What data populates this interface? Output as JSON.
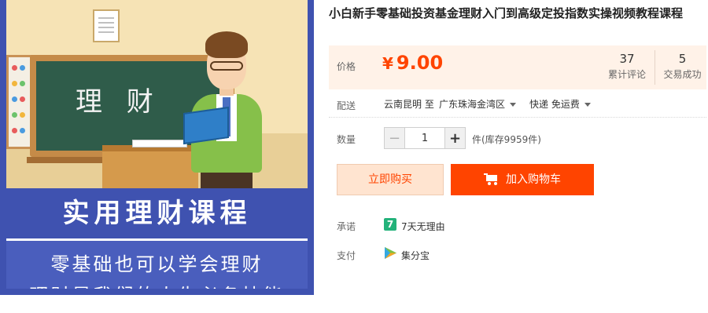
{
  "image": {
    "board_text": "理 财",
    "banner_title": "实用理财课程",
    "banner_line1": "零基础也可以学会理财",
    "banner_line2": "理财是我们的人生必备技能"
  },
  "product": {
    "title": "小白新手零基础投资基金理财入门到高级定投指数实操视频教程课程"
  },
  "price": {
    "label": "价格",
    "currency": "¥",
    "value": "9.00",
    "color": "#ff4400"
  },
  "stats": {
    "reviews_count": "37",
    "reviews_label": "累计评论",
    "sales_count": "5",
    "sales_label": "交易成功"
  },
  "shipping": {
    "label": "配送",
    "from": "云南昆明 至",
    "to": "广东珠海金湾区",
    "express": "快递 免运费"
  },
  "quantity": {
    "label": "数量",
    "value": "1",
    "minus": "−",
    "plus": "+",
    "stock": "件(库存9959件)"
  },
  "actions": {
    "buy_now": "立即购买",
    "add_to_cart": "加入购物车"
  },
  "promise": {
    "label": "承诺",
    "badge": "7",
    "text": "7天无理由"
  },
  "payment": {
    "label": "支付",
    "text": "集分宝",
    "icon": "jifenbao-icon"
  }
}
